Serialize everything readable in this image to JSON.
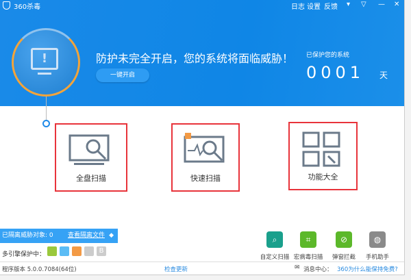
{
  "app": {
    "title": "360杀毒"
  },
  "titlebar": {
    "log": "日志",
    "settings": "设置",
    "feedback": "反馈"
  },
  "status": {
    "headline": "防护未完全开启，您的系统将面临威胁！",
    "enable_button": "一键开启",
    "protected_label": "已保护您的系统",
    "days": "0001",
    "days_unit": "天",
    "monitor_glyph": "!"
  },
  "scans": [
    {
      "label": "全盘扫描"
    },
    {
      "label": "快速扫描"
    },
    {
      "label": "功能大全"
    }
  ],
  "quarantine": {
    "text": "已隔离威胁对象: 0",
    "link": "查看隔离文件"
  },
  "engines": {
    "label": "多引擎保护中：",
    "icons": [
      {
        "name": "cloud",
        "color": "#9ac83c"
      },
      {
        "name": "qvm",
        "color": "#5bbcf5"
      },
      {
        "name": "system-repair",
        "color": "#f39a45"
      },
      {
        "name": "avira",
        "color": "#cccccc"
      },
      {
        "name": "bitdefender",
        "color": "#cccccc",
        "glyph": "B"
      }
    ]
  },
  "tools": [
    {
      "label": "自定义扫描",
      "color": "#1aa08c"
    },
    {
      "label": "宏病毒扫描",
      "color": "#5cb82a"
    },
    {
      "label": "弹窗拦截",
      "color": "#5cb82a"
    },
    {
      "label": "手机助手",
      "color": "#8a8a8a"
    }
  ],
  "footer": {
    "version": "程序版本 5.0.0.7084(64位)",
    "check_update": "检查更新",
    "message_center": "消息中心：",
    "free_link": "360为什么能保持免费?"
  }
}
